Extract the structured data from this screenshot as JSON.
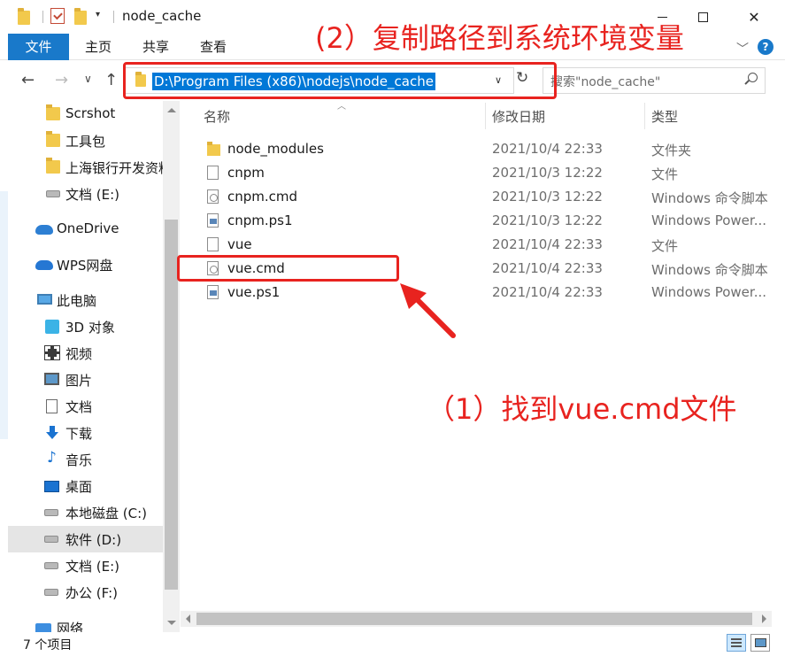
{
  "window": {
    "title": "node_cache"
  },
  "ribbon": {
    "file_tab": "文件",
    "tabs": [
      "主页",
      "共享",
      "查看"
    ]
  },
  "address": {
    "path": "D:\\Program Files (x86)\\nodejs\\node_cache",
    "search_placeholder": "搜索\"node_cache\""
  },
  "annotations": {
    "top": "(2）复制路径到系统环境变量",
    "middle": "（1）找到vue.cmd文件",
    "color": "#e8231f"
  },
  "sidebar": {
    "items": [
      {
        "label": "Scrshot",
        "icon": "folder-icon"
      },
      {
        "label": "工具包",
        "icon": "folder-icon"
      },
      {
        "label": "上海银行开发资料",
        "icon": "folder-icon"
      },
      {
        "label": "文档 (E:)",
        "icon": "drive-icon"
      },
      {
        "label": "OneDrive",
        "icon": "cloud-icon"
      },
      {
        "label": "WPS网盘",
        "icon": "cloud-icon"
      },
      {
        "label": "此电脑",
        "icon": "computer-icon"
      },
      {
        "label": "3D 对象",
        "icon": "cube-icon"
      },
      {
        "label": "视频",
        "icon": "video-icon"
      },
      {
        "label": "图片",
        "icon": "picture-icon"
      },
      {
        "label": "文档",
        "icon": "document-icon"
      },
      {
        "label": "下载",
        "icon": "download-icon"
      },
      {
        "label": "音乐",
        "icon": "music-icon"
      },
      {
        "label": "桌面",
        "icon": "desktop-icon"
      },
      {
        "label": "本地磁盘 (C:)",
        "icon": "drive-icon"
      },
      {
        "label": "软件 (D:)",
        "icon": "drive-icon"
      },
      {
        "label": "文档 (E:)",
        "icon": "drive-icon"
      },
      {
        "label": "办公 (F:)",
        "icon": "drive-icon"
      },
      {
        "label": "网络",
        "icon": "network-icon"
      }
    ]
  },
  "columns": {
    "name": "名称",
    "date": "修改日期",
    "type": "类型"
  },
  "files": [
    {
      "name": "node_modules",
      "date": "2021/10/4 22:33",
      "type": "文件夹",
      "icon": "folder-icon"
    },
    {
      "name": "cnpm",
      "date": "2021/10/3 12:22",
      "type": "文件",
      "icon": "file-icon"
    },
    {
      "name": "cnpm.cmd",
      "date": "2021/10/3 12:22",
      "type": "Windows 命令脚本",
      "icon": "cmd-file-icon"
    },
    {
      "name": "cnpm.ps1",
      "date": "2021/10/3 12:22",
      "type": "Windows Power...",
      "icon": "powershell-file-icon"
    },
    {
      "name": "vue",
      "date": "2021/10/4 22:33",
      "type": "文件",
      "icon": "file-icon"
    },
    {
      "name": "vue.cmd",
      "date": "2021/10/4 22:33",
      "type": "Windows 命令脚本",
      "icon": "cmd-file-icon"
    },
    {
      "name": "vue.ps1",
      "date": "2021/10/4 22:33",
      "type": "Windows Power...",
      "icon": "powershell-file-icon"
    }
  ],
  "status": {
    "count": "7 个项目"
  }
}
